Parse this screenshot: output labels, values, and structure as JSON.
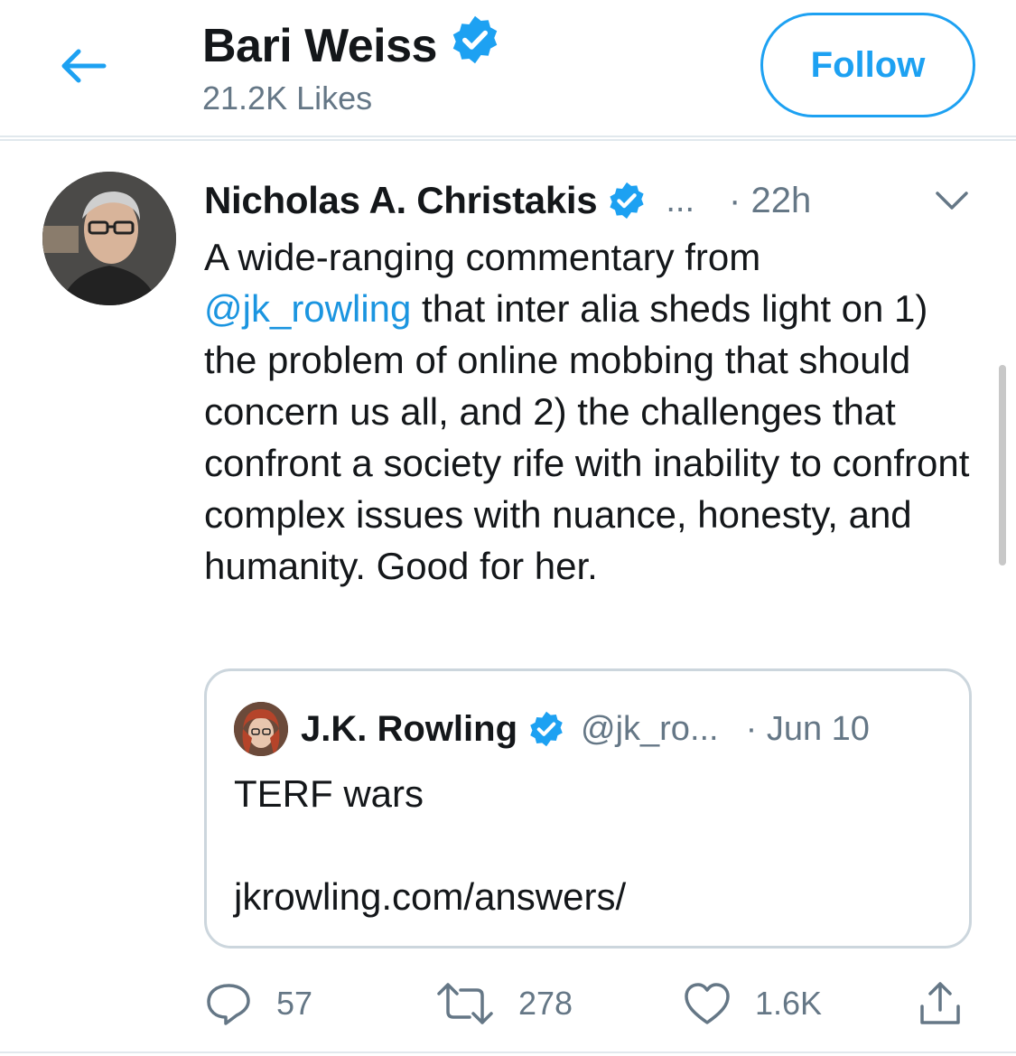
{
  "colors": {
    "accent": "#1da1f2",
    "link": "#1b95e0",
    "secondary_text": "#657786",
    "border": "#ccd6dd"
  },
  "header": {
    "title": "Bari Weiss",
    "subtitle": "21.2K Likes",
    "follow_label": "Follow",
    "back_icon": "back-arrow-icon",
    "verified_icon": "verified-badge-icon"
  },
  "tweet": {
    "author_name": "Nicholas A. Christakis",
    "author_handle": "...",
    "time": "· 22h",
    "text_before_mention": "A wide-ranging commentary from ",
    "mention": "@jk_rowling",
    "text_after_mention": " that inter alia sheds light on 1) the problem of online mobbing that should concern us all, and 2) the challenges that confront a society rife with inability to confront complex issues with nuance, honesty, and humanity. Good for her.",
    "menu_icon": "chevron-down-icon"
  },
  "quote": {
    "author_name": "J.K. Rowling",
    "author_handle": "@jk_ro...",
    "time": "· Jun 10",
    "text": "TERF wars",
    "link": "jkrowling.com/answers/"
  },
  "actions": {
    "reply_count": "57",
    "retweet_count": "278",
    "like_count": "1.6K",
    "reply_icon": "reply-icon",
    "retweet_icon": "retweet-icon",
    "like_icon": "heart-icon",
    "share_icon": "share-icon"
  }
}
